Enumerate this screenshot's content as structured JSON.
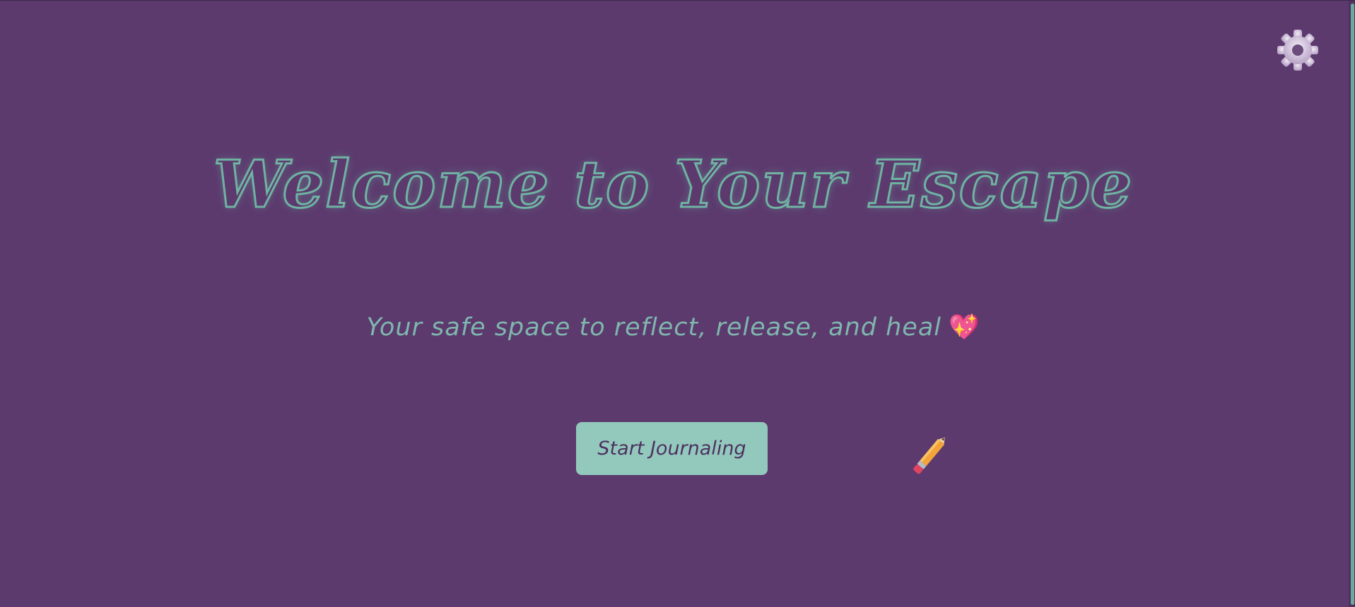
{
  "header": {
    "settings_icon": "gear-icon"
  },
  "hero": {
    "title": "Welcome to Your Escape",
    "subtitle": "Your safe space to reflect, release, and heal",
    "subtitle_emoji": "💖",
    "start_button_label": "Start Journaling",
    "decoration_icon": "pencil-icon"
  },
  "colors": {
    "background": "#5c3a6e",
    "accent_teal": "#6fb3a2",
    "button_bg": "#93c9bd",
    "button_text": "#4d3160",
    "heart": "#e8487e",
    "pencil": "#f2a33a"
  }
}
